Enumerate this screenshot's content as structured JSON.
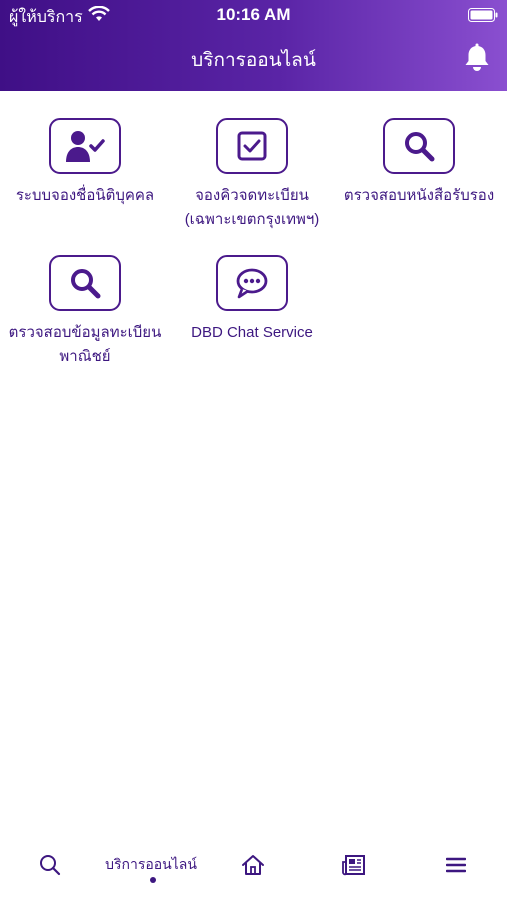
{
  "status_bar": {
    "carrier": "ผู้ให้บริการ",
    "time": "10:16 AM"
  },
  "header": {
    "title": "บริการออนไลน์",
    "bell_icon": "bell-icon"
  },
  "services": [
    {
      "label": "ระบบจองชื่อนิติบุคคล",
      "icon": "user-check-icon"
    },
    {
      "label": "จองคิวจดทะเบียน (เฉพาะเขตกรุงเทพฯ)",
      "icon": "checkbox-icon"
    },
    {
      "label": "ตรวจสอบหนังสือรับรอง",
      "icon": "search-icon"
    },
    {
      "label": "ตรวจสอบข้อมูลทะเบียนพาณิชย์",
      "icon": "search-icon"
    },
    {
      "label": "DBD Chat Service",
      "icon": "chat-icon"
    }
  ],
  "tabbar": {
    "active_label": "บริการออนไลน์",
    "tabs": [
      "search-icon",
      "online-services",
      "home-icon",
      "news-icon",
      "menu-icon"
    ]
  },
  "colors": {
    "primary": "#4b1a8c",
    "header_start": "#3f0f86",
    "header_end": "#8a4fd0"
  }
}
